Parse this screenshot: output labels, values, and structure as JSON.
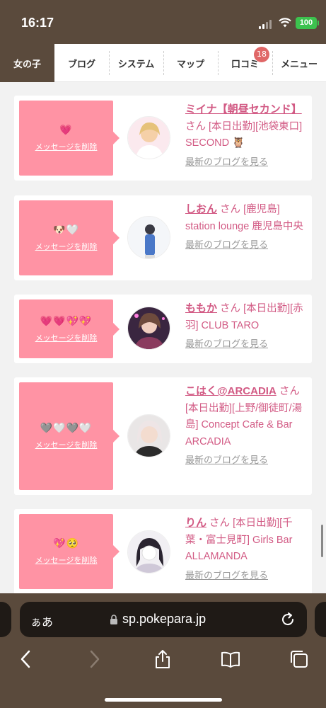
{
  "status": {
    "time": "16:17",
    "battery": "100"
  },
  "nav": {
    "tabs": [
      {
        "label": "女の子",
        "active": true
      },
      {
        "label": "ブログ"
      },
      {
        "label": "システム"
      },
      {
        "label": "マップ"
      },
      {
        "label": "口コミ",
        "badge": "18"
      },
      {
        "label": "メニュー"
      }
    ]
  },
  "cards": [
    {
      "emoji": "💗",
      "delete_label": "メッセージを削除",
      "name": "ミイナ【朝昼セカンド】",
      "san": "さん",
      "details": "[本日出勤][池袋東口] SECOND 🦉",
      "blog_link": "最新のブログを見る"
    },
    {
      "emoji": "🐶🤍",
      "delete_label": "メッセージを削除",
      "name": "しおん",
      "san": "さん",
      "details": "[鹿児島] station lounge 鹿児島中央",
      "blog_link": "最新のブログを見る"
    },
    {
      "emoji": "💗💗💖💖",
      "delete_label": "メッセージを削除",
      "name": "ももか",
      "san": "さん",
      "details": "[本日出勤][赤羽] CLUB TARO",
      "blog_link": "最新のブログを見る"
    },
    {
      "emoji": "🩶🤍🩶🤍",
      "delete_label": "メッセージを削除",
      "name": "こはく@ARCADIA",
      "san": "さん",
      "details": "[本日出勤][上野/御徒町/湯島] Concept Cafe & Bar ARCADIA",
      "blog_link": "最新のブログを見る"
    },
    {
      "emoji": "💖🥺",
      "delete_label": "メッセージを削除",
      "name": "りん",
      "san": "さん",
      "details": "[本日出勤][千葉・富士見町] Girls Bar ALLAMANDA",
      "blog_link": "最新のブログを見る"
    }
  ],
  "browser": {
    "aa_label": "ぁあ",
    "url": "sp.pokepara.jp"
  }
}
